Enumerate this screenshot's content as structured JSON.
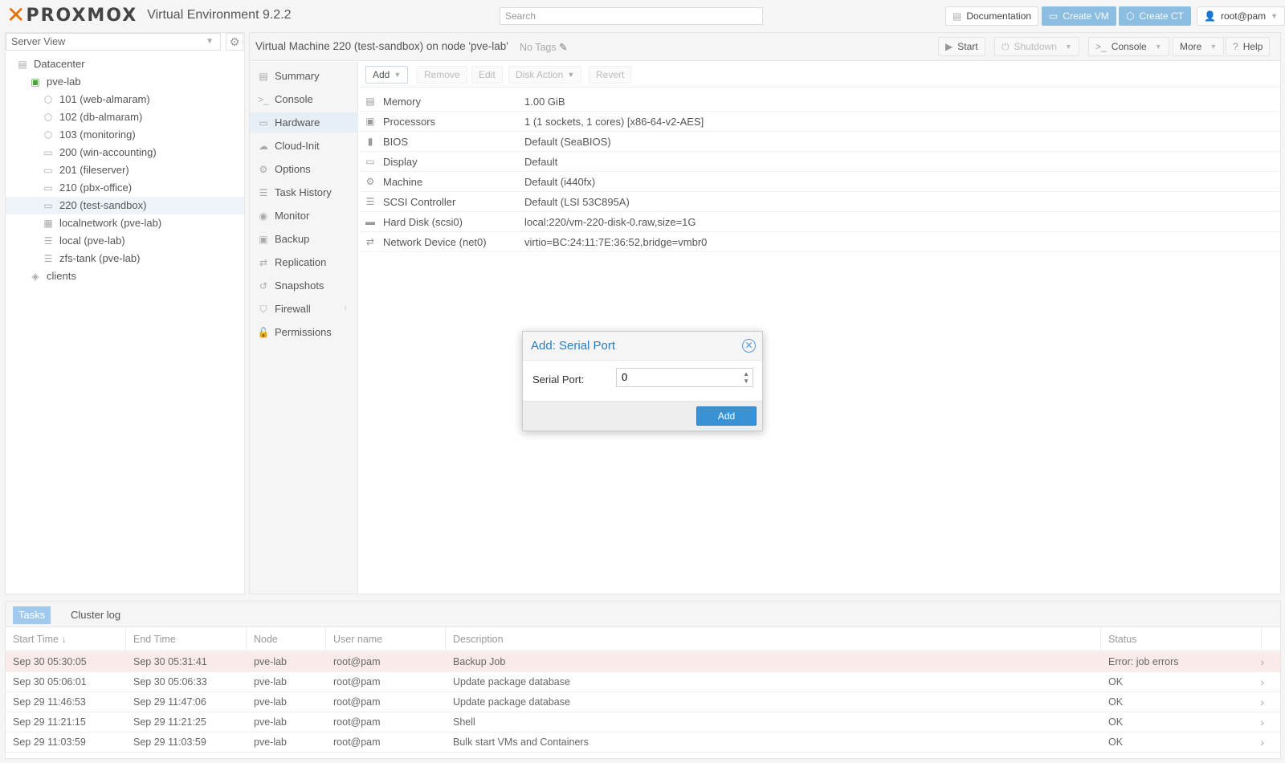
{
  "app": {
    "logo_text": "PROXMOX",
    "version": "Virtual Environment 9.2.2",
    "search_placeholder": "Search",
    "documentation": "Documentation",
    "create_vm": "Create VM",
    "create_ct": "Create CT",
    "user": "root@pam"
  },
  "tree": {
    "view": "Server View",
    "items": [
      {
        "label": "Datacenter"
      },
      {
        "label": "pve-lab"
      },
      {
        "label": "101 (web-almaram)"
      },
      {
        "label": "102 (db-almaram)"
      },
      {
        "label": "103 (monitoring)"
      },
      {
        "label": "200 (win-accounting)"
      },
      {
        "label": "201 (fileserver)"
      },
      {
        "label": "210 (pbx-office)"
      },
      {
        "label": "220 (test-sandbox)"
      },
      {
        "label": "localnetwork (pve-lab)"
      },
      {
        "label": "local (pve-lab)"
      },
      {
        "label": "zfs-tank (pve-lab)"
      },
      {
        "label": "clients"
      }
    ]
  },
  "header": {
    "title": "Virtual Machine 220 (test-sandbox) on node 'pve-lab'",
    "tags": "No Tags",
    "start": "Start",
    "shutdown": "Shutdown",
    "console": "Console",
    "more": "More",
    "help": "Help"
  },
  "nav": [
    {
      "label": "Summary"
    },
    {
      "label": "Console"
    },
    {
      "label": "Hardware"
    },
    {
      "label": "Cloud-Init"
    },
    {
      "label": "Options"
    },
    {
      "label": "Task History"
    },
    {
      "label": "Monitor"
    },
    {
      "label": "Backup"
    },
    {
      "label": "Replication"
    },
    {
      "label": "Snapshots"
    },
    {
      "label": "Firewall"
    },
    {
      "label": "Permissions"
    }
  ],
  "hw_toolbar": {
    "add": "Add",
    "remove": "Remove",
    "edit": "Edit",
    "disk_action": "Disk Action",
    "revert": "Revert"
  },
  "hardware": [
    {
      "key": "Memory",
      "value": "1.00 GiB"
    },
    {
      "key": "Processors",
      "value": "1 (1 sockets, 1 cores) [x86-64-v2-AES]"
    },
    {
      "key": "BIOS",
      "value": "Default (SeaBIOS)"
    },
    {
      "key": "Display",
      "value": "Default"
    },
    {
      "key": "Machine",
      "value": "Default (i440fx)"
    },
    {
      "key": "SCSI Controller",
      "value": "Default (LSI 53C895A)"
    },
    {
      "key": "Hard Disk (scsi0)",
      "value": "local:220/vm-220-disk-0.raw,size=1G"
    },
    {
      "key": "Network Device (net0)",
      "value": "virtio=BC:24:11:7E:36:52,bridge=vmbr0"
    }
  ],
  "dialog": {
    "title": "Add: Serial Port",
    "label": "Serial Port:",
    "value": "0",
    "add": "Add"
  },
  "tasks": {
    "tab_tasks": "Tasks",
    "tab_cluster": "Cluster log",
    "columns": {
      "start": "Start Time",
      "end": "End Time",
      "node": "Node",
      "user": "User name",
      "desc": "Description",
      "status": "Status"
    },
    "rows": [
      {
        "start": "Sep 30 05:30:05",
        "end": "Sep 30 05:31:41",
        "node": "pve-lab",
        "user": "root@pam",
        "desc": "Backup Job",
        "status": "Error: job errors"
      },
      {
        "start": "Sep 30 05:06:01",
        "end": "Sep 30 05:06:33",
        "node": "pve-lab",
        "user": "root@pam",
        "desc": "Update package database",
        "status": "OK"
      },
      {
        "start": "Sep 29 11:46:53",
        "end": "Sep 29 11:47:06",
        "node": "pve-lab",
        "user": "root@pam",
        "desc": "Update package database",
        "status": "OK"
      },
      {
        "start": "Sep 29 11:21:15",
        "end": "Sep 29 11:21:25",
        "node": "pve-lab",
        "user": "root@pam",
        "desc": "Shell",
        "status": "OK"
      },
      {
        "start": "Sep 29 11:03:59",
        "end": "Sep 29 11:03:59",
        "node": "pve-lab",
        "user": "root@pam",
        "desc": "Bulk start VMs and Containers",
        "status": "OK"
      }
    ]
  }
}
